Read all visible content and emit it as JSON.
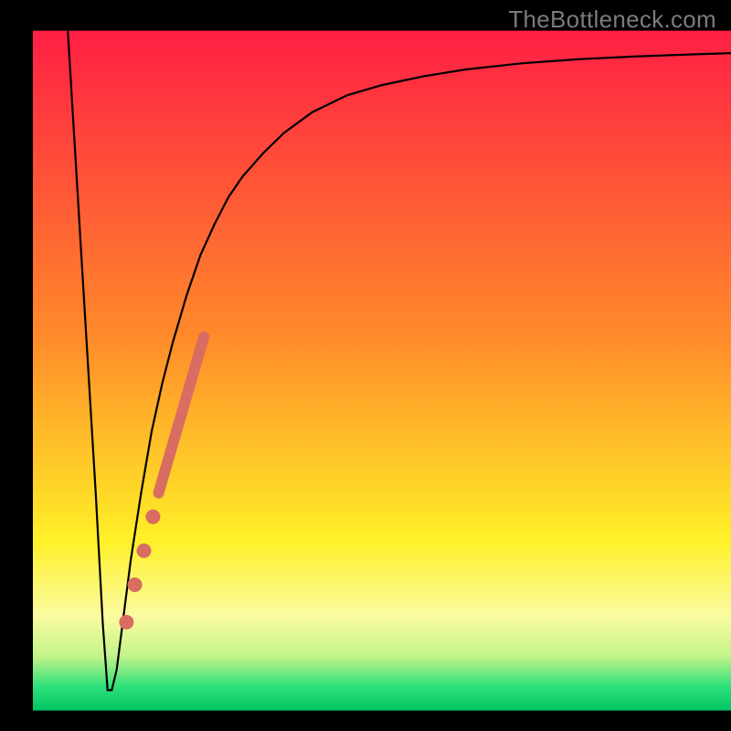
{
  "watermark": "TheBottleneck.com",
  "chart_data": {
    "type": "line",
    "title": "",
    "xlabel": "",
    "ylabel": "",
    "xlim": [
      0,
      100
    ],
    "ylim": [
      0,
      100
    ],
    "background_gradient": {
      "stops": [
        {
          "pos": 0.0,
          "color": "#ff1f44"
        },
        {
          "pos": 0.45,
          "color": "#ff8a2a"
        },
        {
          "pos": 0.75,
          "color": "#fff028"
        },
        {
          "pos": 0.86,
          "color": "#fbfca0"
        },
        {
          "pos": 0.92,
          "color": "#c3f38a"
        },
        {
          "pos": 0.965,
          "color": "#2de07a"
        },
        {
          "pos": 1.0,
          "color": "#00c463"
        }
      ]
    },
    "frame": {
      "x_min": 4.5,
      "x_max": 100,
      "y_min": 4.2,
      "y_max": 97.2
    },
    "series": [
      {
        "name": "bottleneck-curve",
        "type": "line",
        "color": "#000000",
        "width": 2.2,
        "x": [
          5.0,
          7.0,
          9.0,
          10.0,
          10.7,
          11.3,
          12.0,
          13.0,
          14.0,
          15.5,
          17.0,
          18.5,
          20.0,
          22.0,
          24.0,
          26.0,
          28.0,
          30.0,
          33.0,
          36.0,
          40.0,
          45.0,
          50.0,
          56.0,
          62.0,
          70.0,
          78.0,
          86.0,
          94.0,
          100.0
        ],
        "y": [
          100.0,
          66.0,
          32.0,
          13.0,
          3.0,
          3.0,
          6.0,
          14.0,
          22.0,
          32.0,
          41.0,
          48.0,
          54.0,
          61.0,
          67.0,
          71.5,
          75.5,
          78.5,
          82.0,
          85.0,
          88.0,
          90.5,
          92.0,
          93.3,
          94.3,
          95.2,
          95.8,
          96.2,
          96.5,
          96.7
        ]
      },
      {
        "name": "highlight-segment",
        "type": "line",
        "color": "#d96d62",
        "width": 12,
        "linecap": "round",
        "x": [
          18.0,
          24.5
        ],
        "y": [
          32.0,
          55.0
        ]
      },
      {
        "name": "highlight-dots",
        "type": "scatter",
        "color": "#d96d62",
        "radius": 8,
        "x": [
          17.2,
          15.9,
          14.6,
          13.4
        ],
        "y": [
          28.5,
          23.5,
          18.5,
          13.0
        ]
      }
    ]
  }
}
